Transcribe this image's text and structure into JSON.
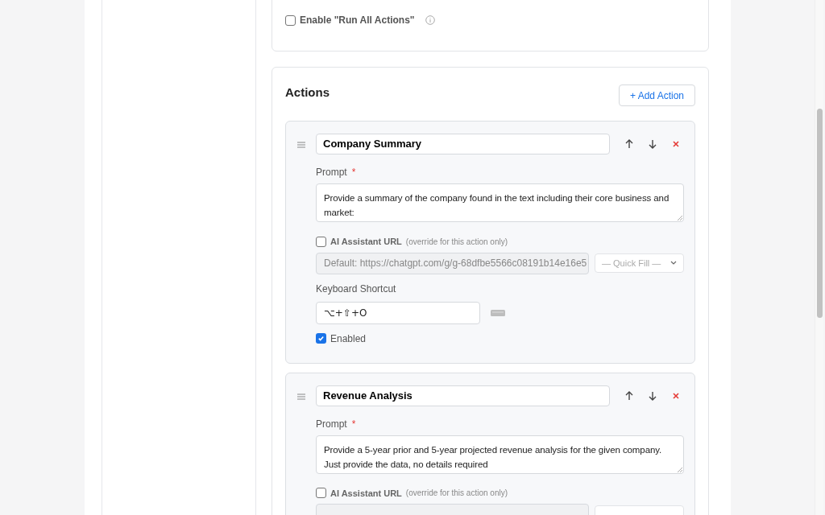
{
  "run_all": {
    "label": "Enable \"Run All Actions\"",
    "checked": false
  },
  "actions_section": {
    "title": "Actions",
    "add_button": "+ Add Action"
  },
  "actions": [
    {
      "name": "Company Summary",
      "prompt_label": "Prompt",
      "required_mark": "*",
      "prompt": "Provide a summary of the company found in the text including their core business and market:",
      "url_label": "AI Assistant URL",
      "url_note": "(override for this action only)",
      "url_override": false,
      "url_placeholder": "Default: https://chatgpt.com/g/g-68dfbe5566c08191b14e16e5",
      "quick_fill": "— Quick Fill —",
      "shortcut_label": "Keyboard Shortcut",
      "shortcut": "⌥+⇧+O",
      "enabled_label": "Enabled",
      "enabled": true
    },
    {
      "name": "Revenue Analysis",
      "prompt_label": "Prompt",
      "required_mark": "*",
      "prompt": "Provide a 5-year prior and 5-year projected revenue analysis for the given company. Just provide the data, no details required",
      "url_label": "AI Assistant URL",
      "url_note": "(override for this action only)",
      "url_override": false
    }
  ]
}
